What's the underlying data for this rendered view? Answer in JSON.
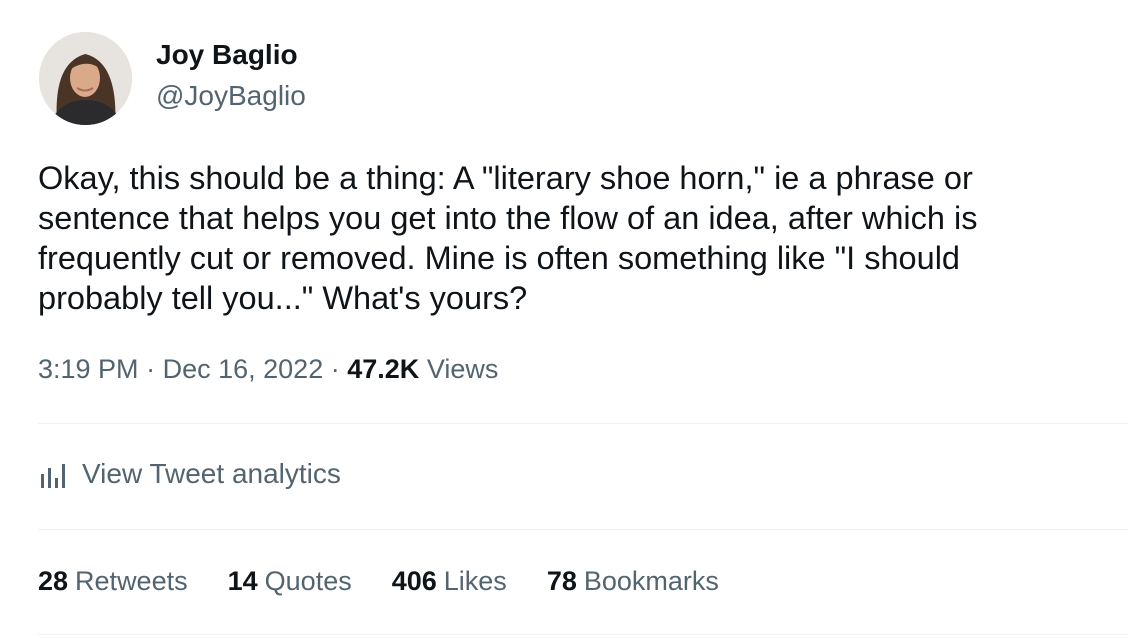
{
  "author": {
    "name": "Joy Baglio",
    "handle": "@JoyBaglio",
    "avatar_icon": "profile-photo"
  },
  "tweet": {
    "text": "Okay, this should be a thing: A \"literary shoe horn,\" ie a phrase or\nsentence that helps you get into the flow of an idea, after which is\nfrequently cut or removed. Mine is often something like \"I should\nprobably tell you...\" What's yours?",
    "time": "3:19 PM",
    "date": "Dec 16, 2022",
    "separator": "·",
    "views_count": "47.2K",
    "views_label": "Views"
  },
  "analytics": {
    "label": "View Tweet analytics",
    "icon": "bar-chart-icon"
  },
  "stats": {
    "retweets": {
      "count": "28",
      "label": "Retweets"
    },
    "quotes": {
      "count": "14",
      "label": "Quotes"
    },
    "likes": {
      "count": "406",
      "label": "Likes"
    },
    "bookmarks": {
      "count": "78",
      "label": "Bookmarks"
    }
  },
  "colors": {
    "text": "#0f1419",
    "secondary": "#536471",
    "divider": "#eff3f4"
  }
}
